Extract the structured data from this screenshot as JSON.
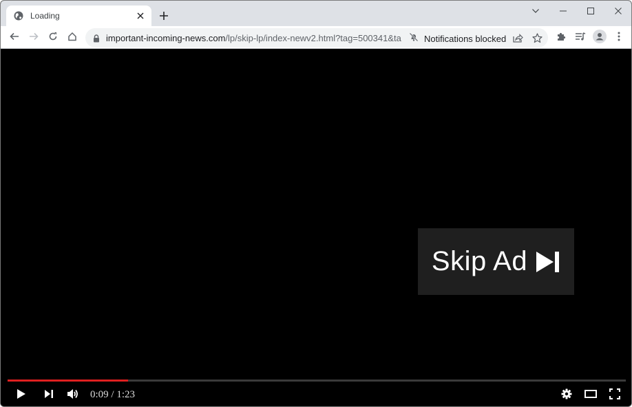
{
  "browser": {
    "tab": {
      "title": "Loading",
      "favicon": "globe-icon"
    },
    "url": {
      "host": "important-incoming-news.com",
      "path": "/lp/skip-lp/index-newv2.html?tag=500341&ta..."
    },
    "notifications_status": "Notifications blocked",
    "icons": {
      "back": "arrow-left-icon",
      "forward": "arrow-right-icon",
      "reload": "reload-icon",
      "home": "home-icon",
      "lock": "lock-icon",
      "share": "share-icon",
      "bookmark": "star-icon",
      "extensions": "puzzle-icon",
      "media": "media-queue-icon",
      "profile": "profile-icon",
      "menu": "kebab-menu-icon"
    }
  },
  "player": {
    "skip_ad_label": "Skip Ad",
    "current_time": "0:09",
    "duration": "1:23",
    "time_display": "0:09 / 1:23",
    "progress_fraction": 0.195,
    "colors": {
      "progress": "#e02020",
      "skip_bg": "#1f1f1f"
    }
  }
}
